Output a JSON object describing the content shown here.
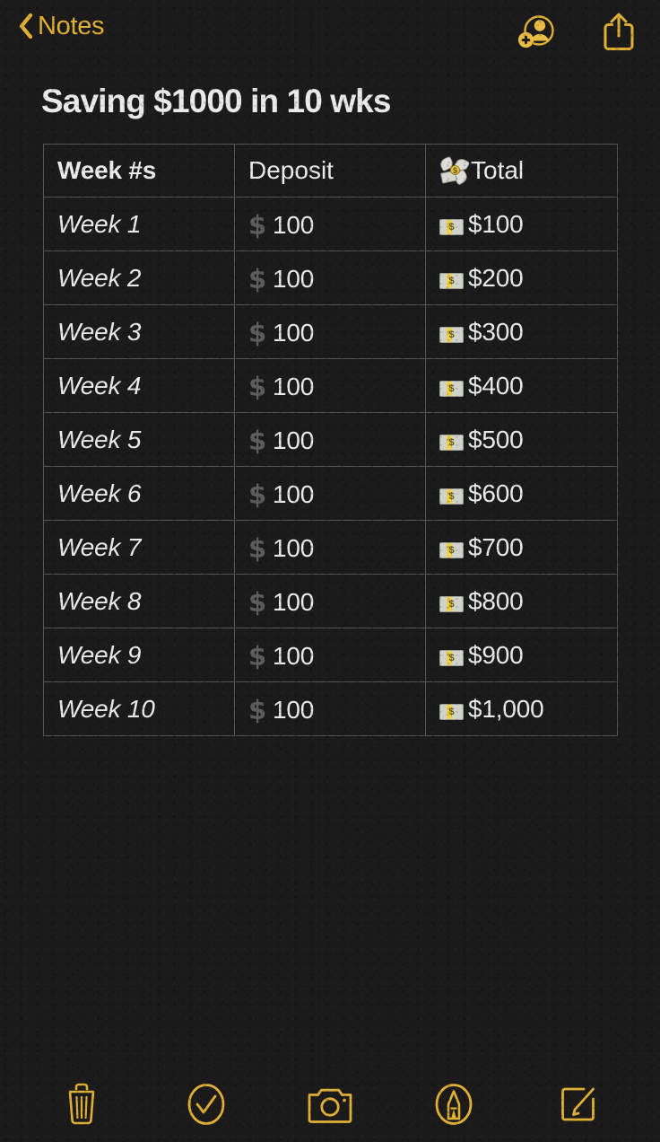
{
  "app": {
    "accent_color": "#e0b036",
    "background_color": "#1b1b1b",
    "text_color": "#eaeaea",
    "border_color": "#565656"
  },
  "navbar": {
    "back_label": "Notes",
    "back_icon": "chevron-left-icon",
    "actions": [
      {
        "name": "add-people-button",
        "icon": "person-badge-plus-icon"
      },
      {
        "name": "share-button",
        "icon": "share-up-arrow-icon"
      }
    ]
  },
  "note": {
    "title": "Saving $1000 in 10 wks"
  },
  "table": {
    "headers": [
      {
        "label": "Week #s",
        "bold": true,
        "icon": ""
      },
      {
        "label": "Deposit",
        "bold": false,
        "icon": ""
      },
      {
        "label": "Total",
        "bold": false,
        "icon": "money-with-wings-emoji"
      }
    ],
    "rows": [
      {
        "week": "Week 1",
        "deposit": "100",
        "total": "$100"
      },
      {
        "week": "Week 2",
        "deposit": "100",
        "total": "$200"
      },
      {
        "week": "Week 3",
        "deposit": "100",
        "total": "$300"
      },
      {
        "week": "Week 4",
        "deposit": "100",
        "total": "$400"
      },
      {
        "week": "Week 5",
        "deposit": "100",
        "total": "$500"
      },
      {
        "week": "Week 6",
        "deposit": "100",
        "total": "$600"
      },
      {
        "week": "Week 7",
        "deposit": "100",
        "total": "$700"
      },
      {
        "week": "Week 8",
        "deposit": "100",
        "total": "$800"
      },
      {
        "week": "Week 9",
        "deposit": "100",
        "total": "$900"
      },
      {
        "week": "Week 10",
        "deposit": "100",
        "total": "$1,000"
      }
    ],
    "deposit_symbol": "$",
    "total_icon": "banknote-emoji"
  },
  "toolbar": {
    "buttons": [
      {
        "name": "delete-button",
        "icon": "trash-icon"
      },
      {
        "name": "checklist-button",
        "icon": "check-circle-icon"
      },
      {
        "name": "camera-button",
        "icon": "camera-icon"
      },
      {
        "name": "markup-button",
        "icon": "pen-circle-icon"
      },
      {
        "name": "compose-button",
        "icon": "compose-icon"
      }
    ]
  }
}
